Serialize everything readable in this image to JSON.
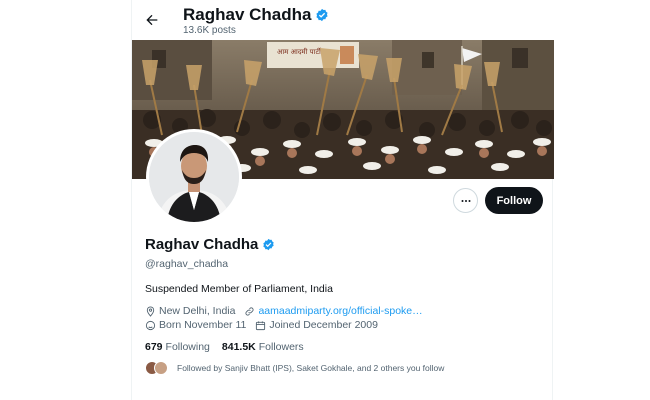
{
  "header": {
    "name": "Raghav Chadha",
    "posts_count": "13.6K posts"
  },
  "banner": {
    "banner_text": "आम आदमी पार्टी"
  },
  "actions": {
    "follow_label": "Follow"
  },
  "profile": {
    "name": "Raghav Chadha",
    "handle": "@raghav_chadha",
    "bio": "Suspended Member of Parliament, India",
    "location": "New Delhi, India",
    "website": "aamaadmiparty.org/official-spoke…",
    "born": "Born November 11",
    "joined": "Joined December 2009",
    "following_count": "679",
    "following_label": "Following",
    "followers_count": "841.5K",
    "followers_label": "Followers",
    "followed_by": "Followed by Sanjiv Bhatt (IPS), Saket Gokhale, and 2 others you follow"
  },
  "colors": {
    "verified": "#1d9bf0",
    "link": "#1d9bf0",
    "follow_bg": "#0f1419",
    "secondary_text": "#536471"
  },
  "icons": [
    "back-arrow-icon",
    "verified-badge-icon",
    "more-icon",
    "location-icon",
    "link-icon",
    "birthday-icon",
    "calendar-icon"
  ]
}
